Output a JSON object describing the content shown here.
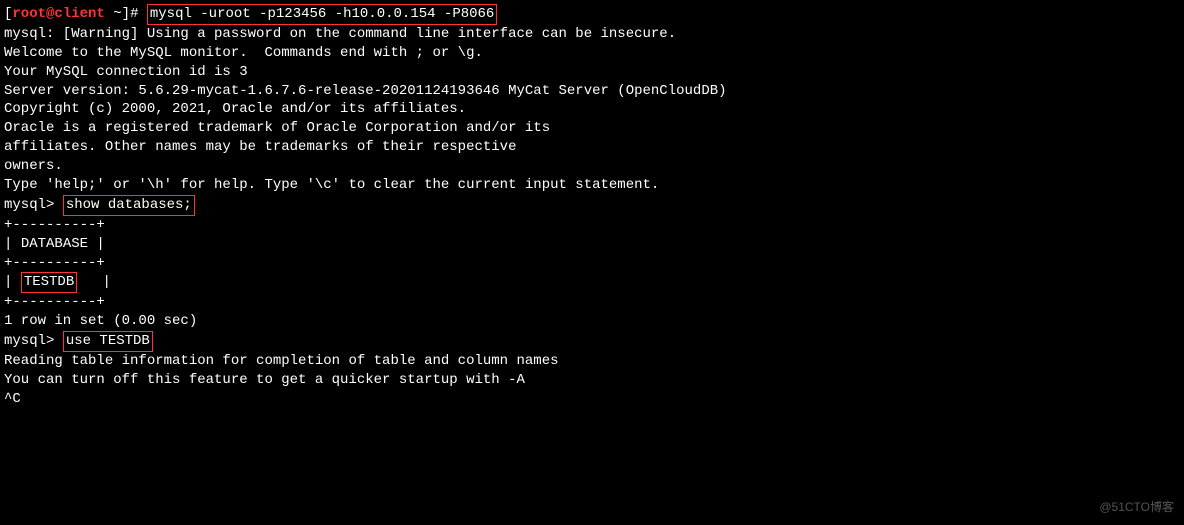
{
  "prompt": {
    "open_bracket": "[",
    "user": "root",
    "at": "@",
    "host": "client",
    "space_tilde": " ~",
    "close_bracket": "]",
    "hash": "# "
  },
  "cmd1": "mysql -uroot -p123456 -h10.0.0.154 -P8066",
  "lines": {
    "warning": "mysql: [Warning] Using a password on the command line interface can be insecure.",
    "welcome": "Welcome to the MySQL monitor.  Commands end with ; or \\g.",
    "connid": "Your MySQL connection id is 3",
    "version": "Server version: 5.6.29-mycat-1.6.7.6-release-20201124193646 MyCat Server (OpenCloudDB)",
    "blank": "",
    "copyright": "Copyright (c) 2000, 2021, Oracle and/or its affiliates.",
    "trademark1": "Oracle is a registered trademark of Oracle Corporation and/or its",
    "trademark2": "affiliates. Other names may be trademarks of their respective",
    "trademark3": "owners.",
    "help": "Type 'help;' or '\\h' for help. Type '\\c' to clear the current input statement."
  },
  "mysql_prompt": "mysql> ",
  "cmd2": "show databases;",
  "table": {
    "border": "+----------+",
    "header_pre": "| ",
    "header": "DATABASE",
    "header_post": " |",
    "row_pre": "| ",
    "row": "TESTDB",
    "row_post": "   |"
  },
  "rowcount": "1 row in set (0.00 sec)",
  "cmd3": "use TESTDB",
  "reading1": "Reading table information for completion of table and column names",
  "reading2": "You can turn off this feature to get a quicker startup with -A",
  "ctrlc": "^C",
  "watermark": "@51CTO博客"
}
